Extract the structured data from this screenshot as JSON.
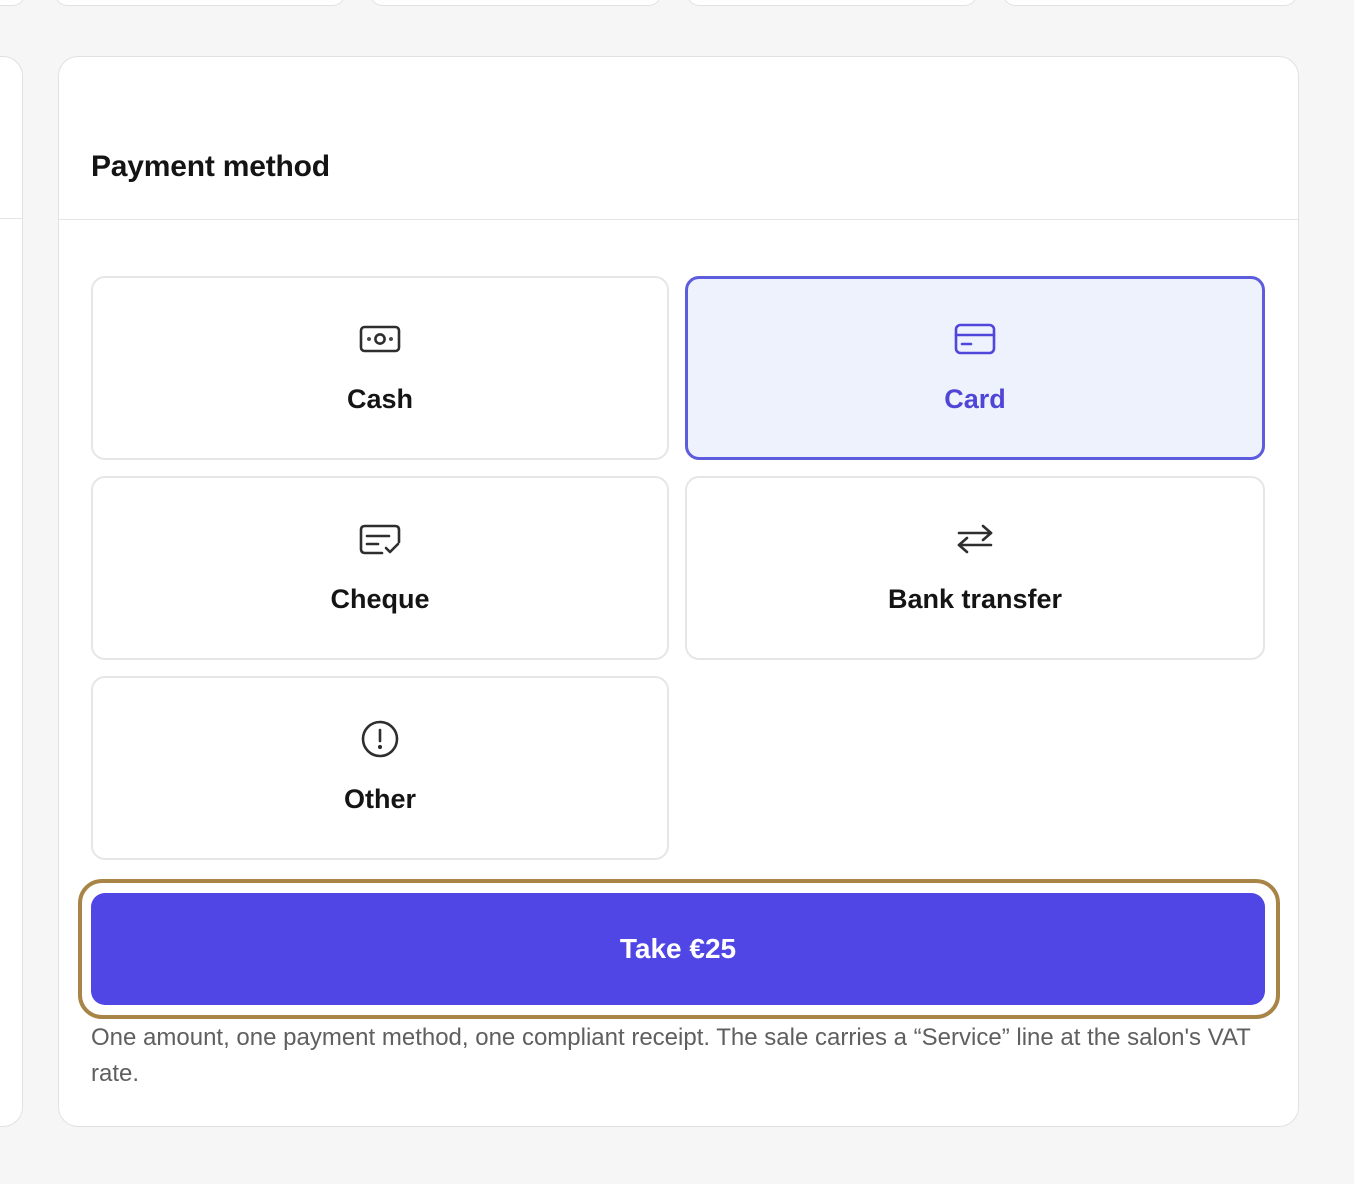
{
  "panel": {
    "title": "Payment method"
  },
  "payment_methods": [
    {
      "label": "Cash",
      "icon": "banknote-icon",
      "selected": false
    },
    {
      "label": "Card",
      "icon": "credit-card-icon",
      "selected": true
    },
    {
      "label": "Cheque",
      "icon": "cheque-icon",
      "selected": false
    },
    {
      "label": "Bank transfer",
      "icon": "transfer-arrows-icon",
      "selected": false
    },
    {
      "label": "Other",
      "icon": "alert-circle-icon",
      "selected": false
    }
  ],
  "take_button": {
    "label": "Take €25"
  },
  "help_text": "One amount, one payment method, one compliant receipt. The sale carries a “Service” line at the salon's VAT rate.",
  "colors": {
    "page_background": "#f6f6f6",
    "accent": "#4f46e5",
    "selected_border": "#5d5cdc",
    "selected_background": "#edf2fd",
    "focus_ring": "#a88547",
    "text_primary": "#141414",
    "text_secondary": "#5f5f5f"
  }
}
